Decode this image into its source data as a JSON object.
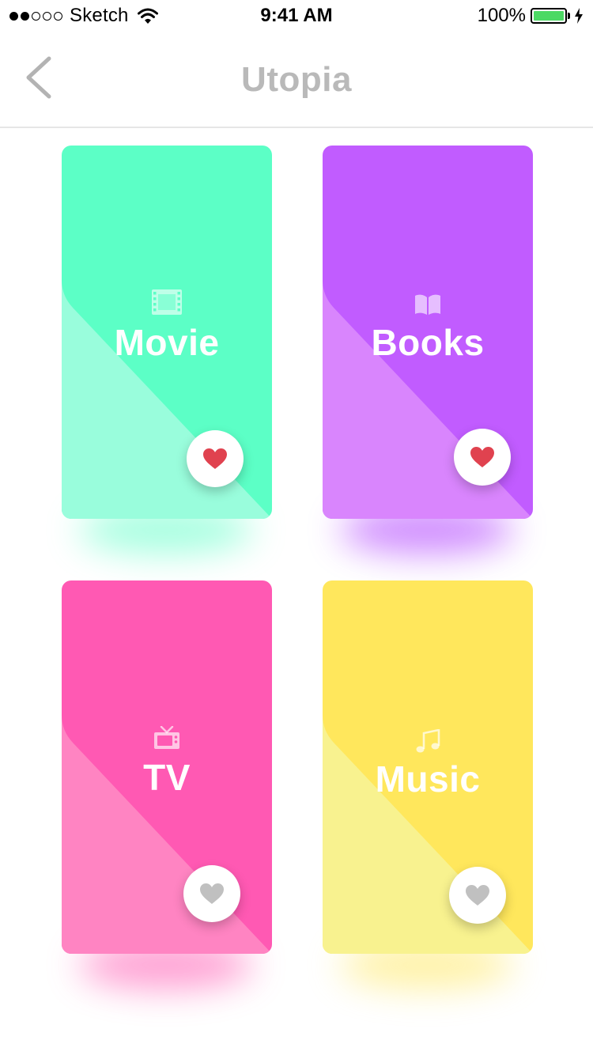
{
  "status_bar": {
    "carrier": "Sketch",
    "time": "9:41 AM",
    "battery_percent": "100%",
    "signal_strength": 2,
    "signal_max": 5,
    "battery_level": 1.0
  },
  "nav": {
    "title": "Utopia",
    "back_icon": "chevron-left-icon"
  },
  "cards": [
    {
      "id": "movie",
      "label": "Movie",
      "icon": "film-icon",
      "color": "#5cffc6",
      "lower_color": "#99fddc",
      "favorite": true
    },
    {
      "id": "books",
      "label": "Books",
      "icon": "book-icon",
      "color": "#c15cff",
      "lower_color": "#d985fd",
      "favorite": true
    },
    {
      "id": "tv",
      "label": "TV",
      "icon": "tv-icon",
      "color": "#ff59b3",
      "lower_color": "#ff84c2",
      "favorite": false
    },
    {
      "id": "music",
      "label": "Music",
      "icon": "music-note-icon",
      "color": "#ffe75c",
      "lower_color": "#f8f28f",
      "favorite": false
    }
  ],
  "colors": {
    "heart_active": "#e0424f",
    "heart_inactive": "#c0c0c0",
    "title": "#b9b9b9"
  }
}
